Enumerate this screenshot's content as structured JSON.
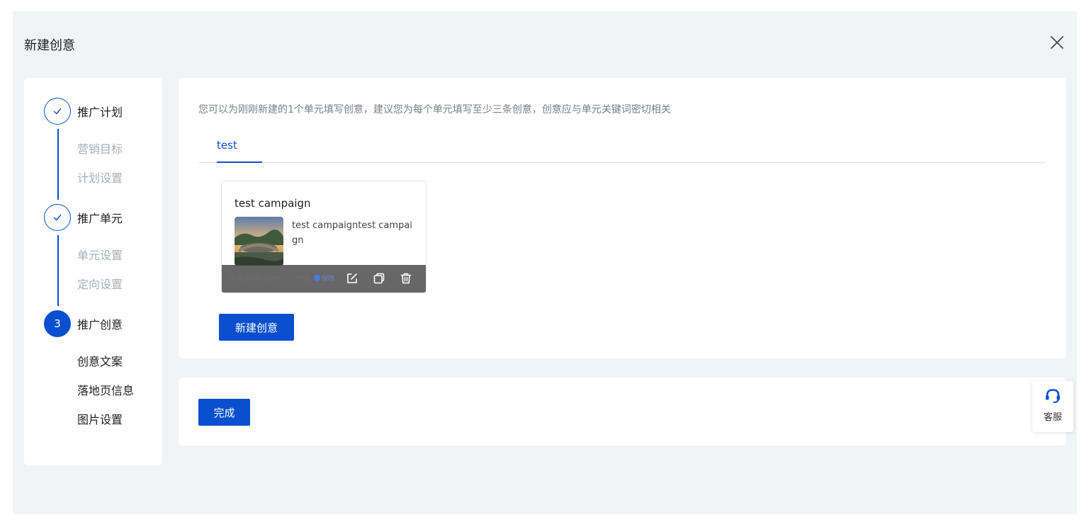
{
  "header": {
    "title": "新建创意"
  },
  "stepper": {
    "steps": [
      {
        "label": "推广计划",
        "status": "done",
        "substeps": [
          "营销目标",
          "计划设置"
        ]
      },
      {
        "label": "推广单元",
        "status": "done",
        "substeps": [
          "单元设置",
          "定向设置"
        ]
      },
      {
        "label": "推广创意",
        "status": "active",
        "number": "3",
        "substeps": [
          "创意文案",
          "落地页信息",
          "图片设置"
        ]
      }
    ]
  },
  "main": {
    "hint": "您可以为刚刚新建的1个单元填写创意，建议您为每个单元填写至少三条创意，创意应与单元关键词密切相关",
    "tabs": [
      {
        "label": "test",
        "active": true
      }
    ],
    "creative_card": {
      "title": "test campaign",
      "description": "test campaigntest campaign",
      "domain": "m.baidu.com",
      "ad_tag": "广告",
      "verify_tag": "保障",
      "actions": [
        "edit-icon",
        "copy-icon",
        "delete-icon"
      ]
    },
    "new_creative_label": "新建创意"
  },
  "footer": {
    "done_label": "完成"
  },
  "service": {
    "label": "客服"
  },
  "colors": {
    "primary": "#0a4fcf",
    "background": "#f2f3f5",
    "muted_text": "#a9aeb8"
  }
}
